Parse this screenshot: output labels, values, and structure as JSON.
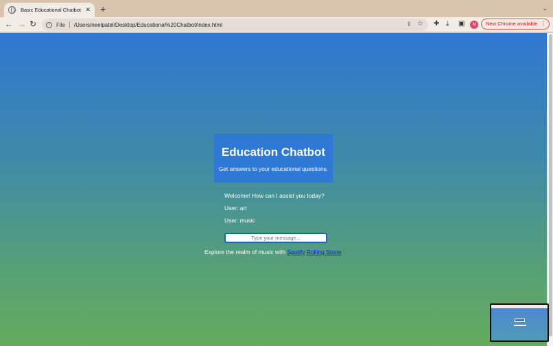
{
  "browser": {
    "tab_title": "Basic Educational Chatbot",
    "url_scheme": "File",
    "url": "/Users/neelpatel/Desktop/Educational%20Chatbot/index.html",
    "update_label": "New Chrome available",
    "avatar_initial": "N"
  },
  "chatbot": {
    "title": "Education Chatbot",
    "subtitle": "Get answers to your educational questions.",
    "messages": [
      "Welcome! How can I assist you today?",
      "User: art",
      "User: music"
    ],
    "input_placeholder": "Type your message...",
    "explore_text": "Explore the realm of music with",
    "links": [
      "Spotify",
      "Rolling Stone"
    ]
  }
}
